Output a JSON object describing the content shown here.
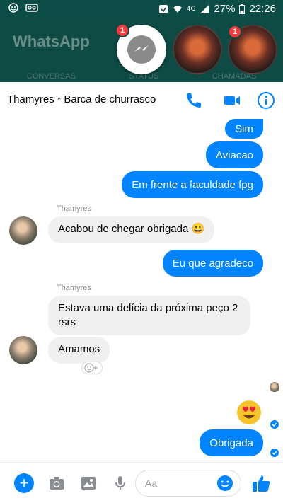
{
  "statusbar": {
    "network": "4G",
    "battery": "27%",
    "time": "22:26"
  },
  "background_app": {
    "title": "WhatsApp",
    "tabs": [
      "CONVERSAS",
      "STATUS",
      "CHAMADAS"
    ]
  },
  "chat_heads": [
    {
      "name": "messenger",
      "badge": "1"
    },
    {
      "name": "contact-photo-1"
    },
    {
      "name": "contact-photo-2",
      "badge": "1"
    }
  ],
  "header": {
    "title": "Thamyres ◦ Barca de churrasco",
    "icons": [
      "phone-icon",
      "video-icon",
      "info-icon"
    ]
  },
  "messages": [
    {
      "dir": "out",
      "text": "Sim"
    },
    {
      "dir": "out",
      "text": "Aviacao"
    },
    {
      "dir": "out",
      "text": "Em frente a faculdade fpg"
    },
    {
      "dir": "in",
      "sender": "Thamyres",
      "text": "Acabou de chegar obrigada 😀"
    },
    {
      "dir": "out",
      "text": "Eu que agradeco"
    },
    {
      "dir": "in",
      "sender": "Thamyres",
      "text": "Estava uma delícia da próxima peço 2 rsrs"
    },
    {
      "dir": "in",
      "text": "Amamos"
    },
    {
      "dir": "out",
      "text": "😍"
    },
    {
      "dir": "out",
      "text": "Obrigada"
    }
  ],
  "composer": {
    "placeholder": "Aa"
  },
  "colors": {
    "accent": "#0084ff",
    "incoming_bubble": "#f1f0f0",
    "statusbar": "#0b4d46"
  }
}
